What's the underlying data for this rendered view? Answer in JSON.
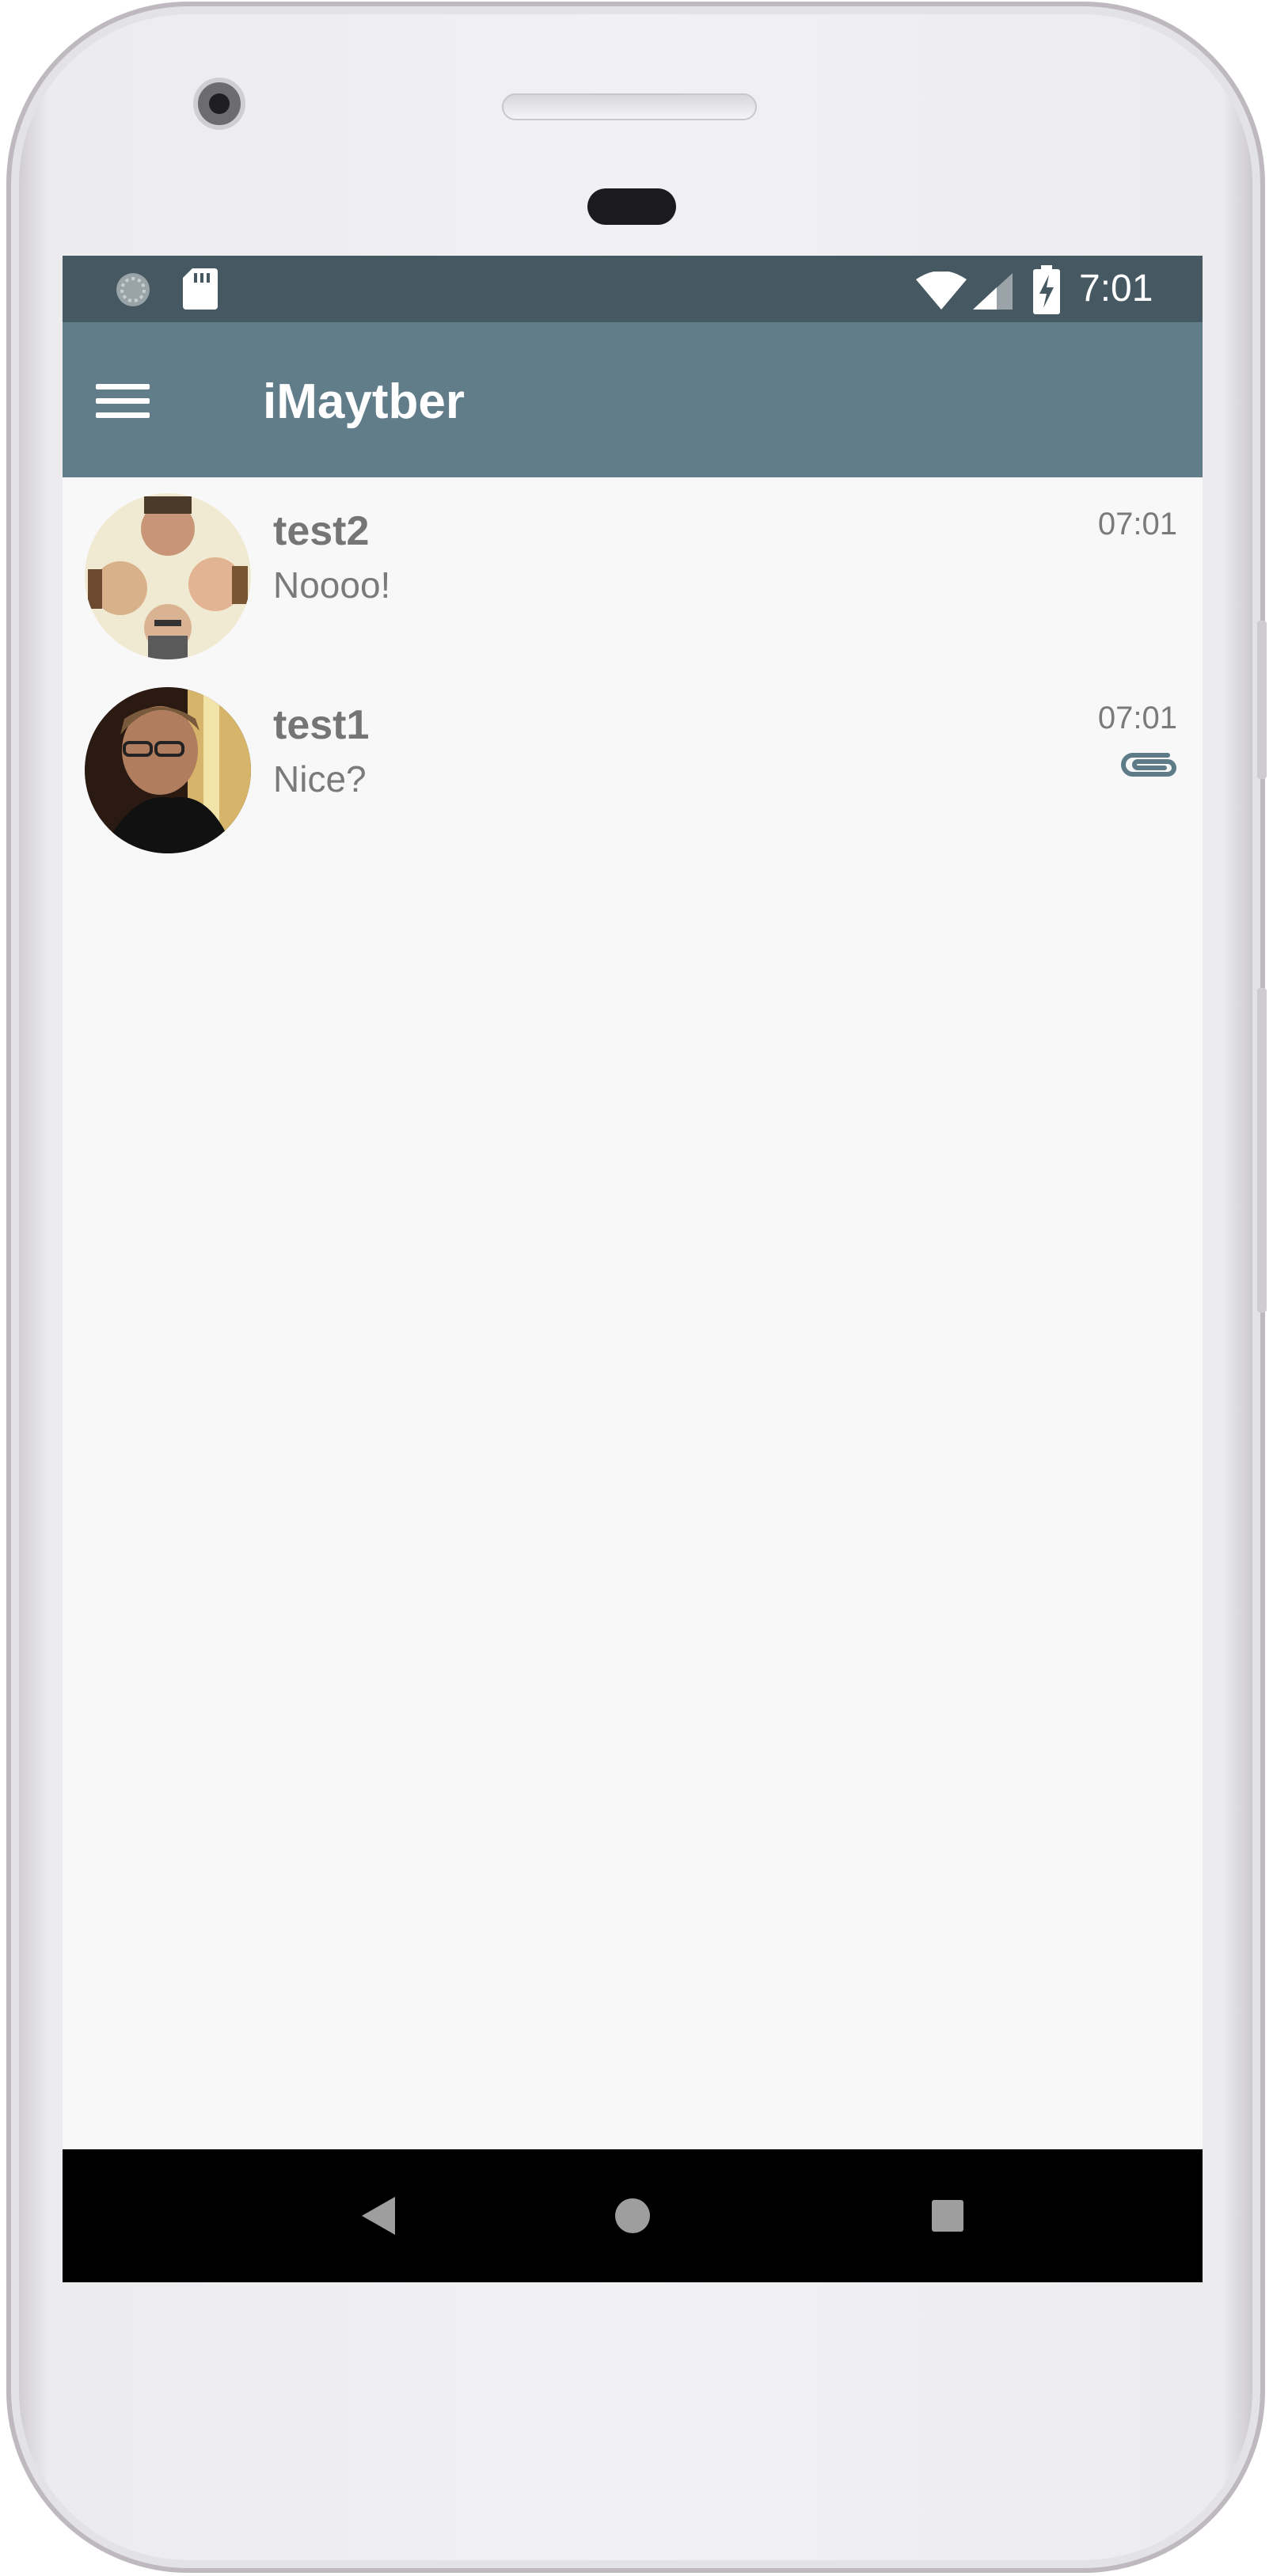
{
  "status_bar": {
    "time": "7:01",
    "left_icons": [
      "sync-icon",
      "sd-card-icon"
    ],
    "right_icons": [
      "wifi-icon",
      "cell-signal-icon",
      "battery-charging-icon"
    ]
  },
  "app_bar": {
    "title": "iMaytber",
    "menu_icon": "menu-icon"
  },
  "chats": [
    {
      "name": "test2",
      "preview": "Noooo!",
      "time": "07:01",
      "has_attachment": false
    },
    {
      "name": "test1",
      "preview": "Nice?",
      "time": "07:01",
      "has_attachment": true
    }
  ],
  "nav_bar": {
    "buttons": [
      "back-icon",
      "home-icon",
      "recents-icon"
    ]
  },
  "colors": {
    "status_bar": "#465962",
    "app_bar": "#617d8a",
    "background": "#f8f8f9",
    "attachment_icon": "#5e7b88"
  }
}
